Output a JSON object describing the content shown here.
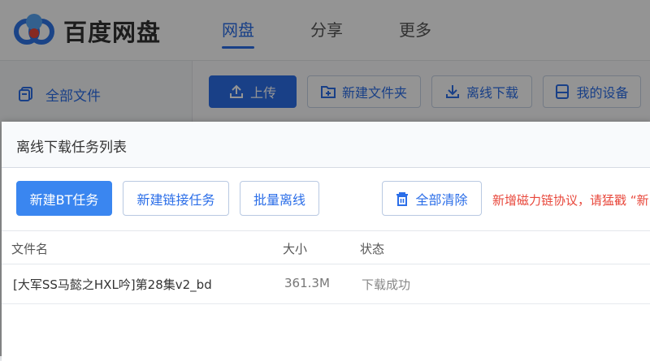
{
  "app": {
    "brand": "百度网盘"
  },
  "nav": {
    "tabs": [
      {
        "label": "网盘"
      },
      {
        "label": "分享"
      },
      {
        "label": "更多"
      }
    ]
  },
  "sidebar": {
    "items": [
      {
        "label": "全部文件"
      }
    ]
  },
  "toolbar": {
    "upload_label": "上传",
    "new_folder_label": "新建文件夹",
    "offline_download_label": "离线下载",
    "my_devices_label": "我的设备"
  },
  "dialog": {
    "title": "离线下载任务列表",
    "new_bt_label": "新建BT任务",
    "new_link_label": "新建链接任务",
    "batch_offline_label": "批量离线",
    "clear_all_label": "全部清除",
    "notice": "新增磁力链协议，请猛戳 “新",
    "columns": {
      "name": "文件名",
      "size": "大小",
      "status": "状态"
    },
    "rows": [
      {
        "name": "[大军SS马懿之HXL吟]第28集v2_bd",
        "size": "361.3M",
        "status": "下载成功"
      }
    ]
  },
  "colors": {
    "accent": "#2b6ee8",
    "notice": "#e8473b"
  }
}
